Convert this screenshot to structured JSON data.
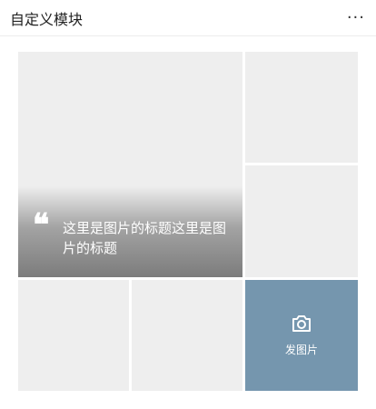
{
  "header": {
    "title": "自定义模块",
    "more_icon": "more-icon"
  },
  "grid": {
    "featured": {
      "quote_icon": "quote-icon",
      "caption": "这里是图片的标题这里是图片的标题"
    },
    "add_photo": {
      "icon": "camera-icon",
      "label": "发图片"
    },
    "colors": {
      "placeholder": "#eeeeee",
      "add_photo_bg": "#7596ae"
    }
  }
}
